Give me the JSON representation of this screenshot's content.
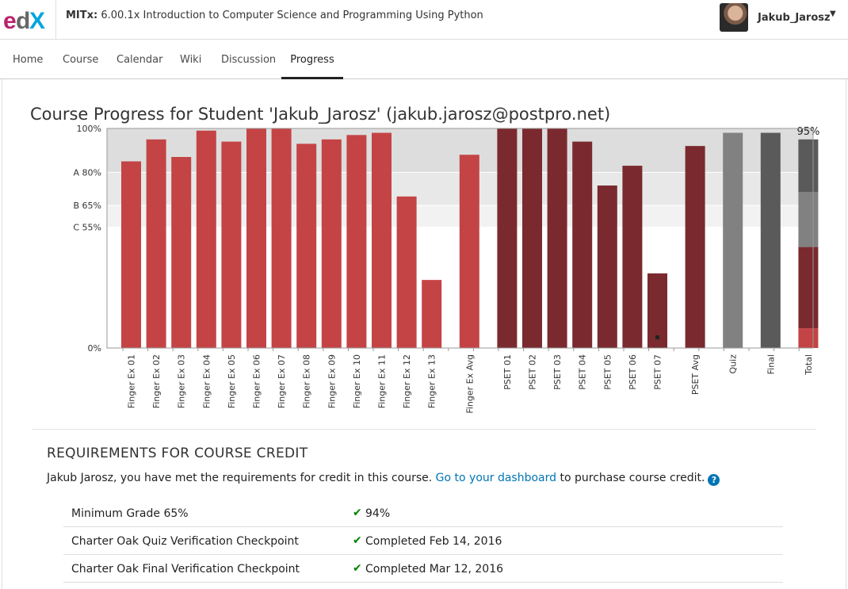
{
  "header": {
    "logo_text": "edX",
    "course_org": "MITx:",
    "course_name": "6.00.1x Introduction to Computer Science and Programming Using Python",
    "username": "Jakub_Jarosz",
    "caret": "▼"
  },
  "nav": {
    "tabs": [
      {
        "label": "Home"
      },
      {
        "label": "Course"
      },
      {
        "label": "Calendar"
      },
      {
        "label": "Wiki"
      },
      {
        "label": "Discussion"
      },
      {
        "label": "Progress"
      }
    ],
    "active": "Progress"
  },
  "page": {
    "title": "Course Progress for Student 'Jakub_Jarosz' (jakub.jarosz@postpro.net)"
  },
  "chart_data": {
    "type": "bar",
    "y_ticks": [
      {
        "label": "100%",
        "value": 100
      },
      {
        "label": "A 80%",
        "value": 80
      },
      {
        "label": "B 65%",
        "value": 65
      },
      {
        "label": "C 55%",
        "value": 55
      },
      {
        "label": "0%",
        "value": 0
      }
    ],
    "ylim": [
      0,
      100
    ],
    "grade_bands": [
      {
        "from": 80,
        "to": 100,
        "color": "#dddddd"
      },
      {
        "from": 65,
        "to": 80,
        "color": "#e8e8e8"
      },
      {
        "from": 55,
        "to": 65,
        "color": "#f2f2f2"
      }
    ],
    "groups": [
      {
        "color": "#c44445",
        "bars": [
          {
            "label": "Finger Ex 01",
            "value": 85
          },
          {
            "label": "Finger Ex 02",
            "value": 95
          },
          {
            "label": "Finger Ex 03",
            "value": 87
          },
          {
            "label": "Finger Ex 04",
            "value": 99
          },
          {
            "label": "Finger Ex 05",
            "value": 94
          },
          {
            "label": "Finger Ex 06",
            "value": 100
          },
          {
            "label": "Finger Ex 07",
            "value": 100
          },
          {
            "label": "Finger Ex 08",
            "value": 93
          },
          {
            "label": "Finger Ex 09",
            "value": 95
          },
          {
            "label": "Finger Ex 10",
            "value": 97
          },
          {
            "label": "Finger Ex 11",
            "value": 98
          },
          {
            "label": "Finger Ex 12",
            "value": 69
          },
          {
            "label": "Finger Ex 13",
            "value": 31
          },
          {
            "label": "Finger Ex Avg",
            "value": 88,
            "gap_before": true
          }
        ]
      },
      {
        "color": "#7a2a2e",
        "bars": [
          {
            "label": "PSET 01",
            "value": 100,
            "gap_before": true
          },
          {
            "label": "PSET 02",
            "value": 100
          },
          {
            "label": "PSET 03",
            "value": 100
          },
          {
            "label": "PSET 04",
            "value": 94
          },
          {
            "label": "PSET 05",
            "value": 74
          },
          {
            "label": "PSET 06",
            "value": 83
          },
          {
            "label": "PSET 07",
            "value": 34
          },
          {
            "label": "PSET Avg",
            "value": 92,
            "gap_before": true
          }
        ]
      },
      {
        "color": "#818181",
        "bars": [
          {
            "label": "Quiz",
            "value": 98,
            "gap_before": true
          }
        ]
      },
      {
        "color": "#5a5a5a",
        "bars": [
          {
            "label": "Final",
            "value": 98,
            "gap_before": true
          }
        ]
      }
    ],
    "total": {
      "label": "Total",
      "value_label": "95%",
      "segments": [
        {
          "value": 9,
          "color": "#c44445"
        },
        {
          "value": 37,
          "color": "#7a2a2e"
        },
        {
          "value": 25,
          "color": "#818181"
        },
        {
          "value": 24,
          "color": "#5a5a5a"
        }
      ]
    },
    "dropped_marker_on": "PSET 07"
  },
  "requirements": {
    "title": "REQUIREMENTS FOR COURSE CREDIT",
    "message_before": "Jakub Jarosz, you have met the requirements for credit in this course. ",
    "link_text": "Go to your dashboard",
    "message_after": " to purchase course credit.",
    "help_icon": "?",
    "rows": [
      {
        "label": "Minimum Grade 65%",
        "value": "94%"
      },
      {
        "label": "Charter Oak Quiz Verification Checkpoint",
        "value": "Completed Feb 14, 2016"
      },
      {
        "label": "Charter Oak Final Verification Checkpoint",
        "value": "Completed Mar 12, 2016"
      }
    ],
    "check_icon": "✔"
  }
}
